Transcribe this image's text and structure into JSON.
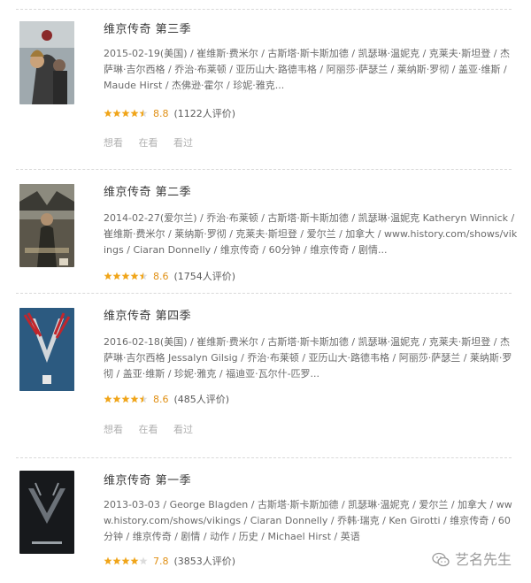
{
  "results": [
    {
      "title": "维京传奇 第三季",
      "meta": "2015-02-19(美国) / 崔维斯·费米尔 / 古斯塔·斯卡斯加德 / 凯瑟琳·温妮克 / 克莱夫·斯坦登 / 杰萨琳·吉尔西格 / 乔治·布莱顿 / 亚历山大·路德韦格 / 阿丽莎·萨瑟兰 / 莱纳斯·罗彻 / 盖亚·维斯 / Maude Hirst / 杰佛逊·霍尔 / 珍妮·雅克...",
      "score": "8.8",
      "votes": "(1122人评价)",
      "stars": 4.5,
      "actions": [
        "想看",
        "在看",
        "看过"
      ]
    },
    {
      "title": "维京传奇 第二季",
      "meta": "2014-02-27(爱尔兰) / 乔治·布莱顿 / 古斯塔·斯卡斯加德 / 凯瑟琳·温妮克 Katheryn Winnick / 崔维斯·费米尔 / 莱纳斯·罗彻 / 克莱夫·斯坦登 / 爱尔兰 / 加拿大 / www.history.com/shows/vikings / Ciaran Donnelly / 维京传奇 / 60分钟 / 维京传奇 / 剧情...",
      "score": "8.6",
      "votes": "(1754人评价)",
      "stars": 4.5,
      "actions": []
    },
    {
      "title": "维京传奇 第四季",
      "meta": "2016-02-18(美国) / 崔维斯·费米尔 / 古斯塔·斯卡斯加德 / 凯瑟琳·温妮克 / 克莱夫·斯坦登 / 杰萨琳·吉尔西格 Jessalyn Gilsig / 乔治·布莱顿 / 亚历山大·路德韦格 / 阿丽莎·萨瑟兰 / 莱纳斯·罗彻 / 盖亚·维斯 / 珍妮·雅克 / 福迪亚·瓦尔什-匹罗...",
      "score": "8.6",
      "votes": "(485人评价)",
      "stars": 4.5,
      "actions": [
        "想看",
        "在看",
        "看过"
      ]
    },
    {
      "title": "维京传奇 第一季",
      "meta": "2013-03-03 / George Blagden / 古斯塔·斯卡斯加德 / 凯瑟琳·温妮克 / 爱尔兰 / 加拿大 / www.history.com/shows/vikings / Ciaran Donnelly / 乔韩·瑞克 / Ken Girotti / 维京传奇 / 60分钟 / 维京传奇 / 剧情 / 动作 / 历史 / Michael Hirst / 英语",
      "score": "7.8",
      "votes": "(3853人评价)",
      "stars": 4,
      "actions": []
    }
  ],
  "watermark": {
    "text": "艺名先生"
  },
  "colors": {
    "star": "#f0a51a",
    "star_empty": "#dcdcdc",
    "score": "#e09015"
  },
  "icons": {
    "star": "star-icon",
    "watermark_logo": "wechat-logo-icon"
  }
}
